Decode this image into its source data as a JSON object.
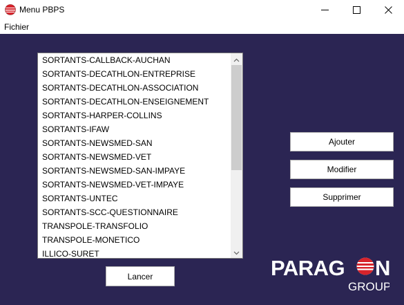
{
  "window": {
    "title": "Menu PBPS",
    "icon": "paragon-ball-icon",
    "controls": [
      "minimize-icon",
      "maximize-icon",
      "close-icon"
    ]
  },
  "menubar": {
    "items": [
      {
        "label": "Fichier"
      }
    ]
  },
  "list": {
    "items": [
      "SORTANTS-CALLBACK-AUCHAN",
      "SORTANTS-DECATHLON-ENTREPRISE",
      "SORTANTS-DECATHLON-ASSOCIATION",
      "SORTANTS-DECATHLON-ENSEIGNEMENT",
      "SORTANTS-HARPER-COLLINS",
      "SORTANTS-IFAW",
      "SORTANTS-NEWSMED-SAN",
      "SORTANTS-NEWSMED-VET",
      "SORTANTS-NEWSMED-SAN-IMPAYE",
      "SORTANTS-NEWSMED-VET-IMPAYE",
      "SORTANTS-UNTEC",
      "SORTANTS-SCC-QUESTIONNAIRE",
      "TRANSPOLE-TRANSFOLIO",
      "TRANSPOLE-MONETICO",
      "ILLICO-SURET"
    ]
  },
  "buttons": {
    "add": "Ajouter",
    "edit": "Modifier",
    "delete": "Supprimer",
    "launch": "Lancer"
  },
  "logo": {
    "text_before": "PARAG",
    "text_after": "N",
    "subtitle": "GROUP"
  },
  "colors": {
    "background": "#2b2553",
    "logo_red": "#d7232b"
  }
}
